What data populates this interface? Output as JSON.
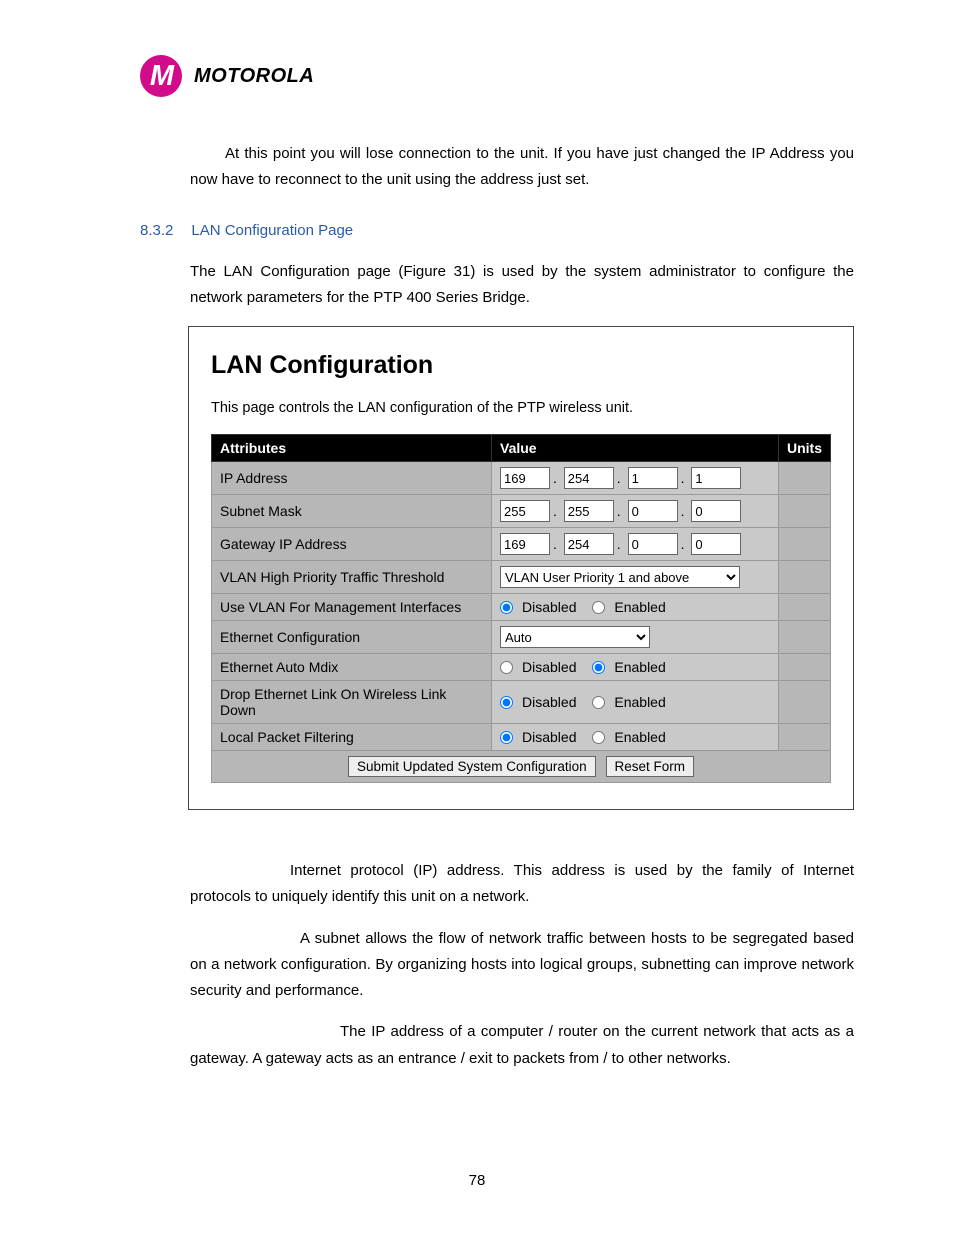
{
  "brand": "MOTOROLA",
  "intro": "At this point you will lose connection to the unit. If you have just changed the IP Address you now have to reconnect to the unit using the address just set.",
  "section": {
    "num": "8.3.2",
    "title": "LAN Configuration Page"
  },
  "section_body": "The LAN Configuration page (Figure 31) is used by the system administrator to configure the network parameters for the PTP 400 Series Bridge.",
  "panel": {
    "title": "LAN Configuration",
    "desc": "This page controls the LAN configuration of the PTP wireless unit.",
    "headers": {
      "attr": "Attributes",
      "value": "Value",
      "units": "Units"
    },
    "rows": {
      "ip": {
        "label": "IP Address",
        "o1": "169",
        "o2": "254",
        "o3": "1",
        "o4": "1"
      },
      "mask": {
        "label": "Subnet Mask",
        "o1": "255",
        "o2": "255",
        "o3": "0",
        "o4": "0"
      },
      "gw": {
        "label": "Gateway IP Address",
        "o1": "169",
        "o2": "254",
        "o3": "0",
        "o4": "0"
      },
      "vlanprio": {
        "label": "VLAN High Priority Traffic Threshold",
        "selected": "VLAN User Priority 1 and above"
      },
      "vlanmgmt": {
        "label": "Use VLAN For Management Interfaces",
        "opt1": "Disabled",
        "opt2": "Enabled"
      },
      "ethcfg": {
        "label": "Ethernet Configuration",
        "selected": "Auto"
      },
      "mdix": {
        "label": "Ethernet Auto Mdix",
        "opt1": "Disabled",
        "opt2": "Enabled"
      },
      "drop": {
        "label": "Drop Ethernet Link On Wireless Link Down",
        "opt1": "Disabled",
        "opt2": "Enabled"
      },
      "filter": {
        "label": "Local Packet Filtering",
        "opt1": "Disabled",
        "opt2": "Enabled"
      }
    },
    "buttons": {
      "submit": "Submit Updated System Configuration",
      "reset": "Reset Form"
    }
  },
  "def_ip": "Internet protocol (IP) address. This address is used by the family of Internet protocols to uniquely identify this unit on a network.",
  "def_mask": "A subnet allows the flow of network traffic between hosts to be segregated based on a network configuration. By organizing hosts into logical groups, subnetting can improve network security and performance.",
  "def_gw": "The IP address of a computer / router on the current network that acts as a gateway. A gateway acts as an entrance / exit to packets from / to other networks.",
  "page_num": "78"
}
